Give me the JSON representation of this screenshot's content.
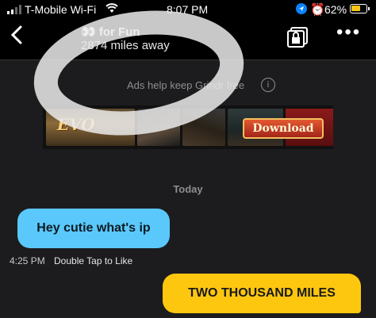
{
  "status_bar": {
    "carrier": "T-Mobile Wi-Fi",
    "time": "8:07 PM",
    "battery_percent": "62%",
    "battery_level": 0.62
  },
  "header": {
    "title": "👀 for Fun",
    "subtitle": "2874 miles away"
  },
  "ad": {
    "note": "Ads help keep Grindr free",
    "logo_text": "EVO",
    "cta_label": "Download"
  },
  "chat": {
    "day_label": "Today",
    "messages": [
      {
        "direction": "incoming",
        "text": "Hey cutie what's ip",
        "time": "4:25 PM",
        "hint": "Double Tap to Like"
      },
      {
        "direction": "outgoing",
        "text": "TWO THOUSAND MILES"
      }
    ]
  },
  "colors": {
    "incoming_bubble": "#5ac8fa",
    "outgoing_bubble": "#fdc70f",
    "background": "#1c1c1e"
  }
}
